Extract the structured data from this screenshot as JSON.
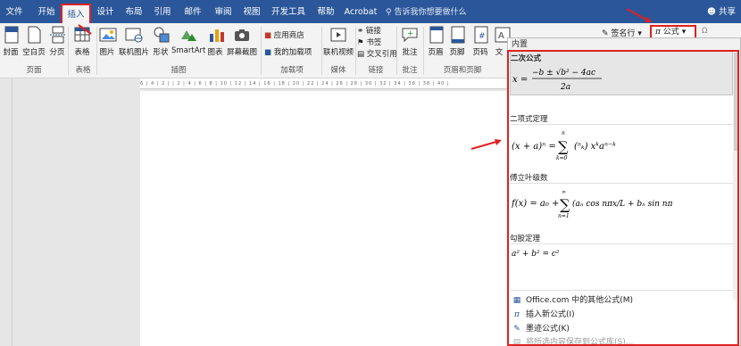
{
  "tabs": [
    {
      "label": "文件",
      "active": false
    },
    {
      "label": "开始",
      "active": false
    },
    {
      "label": "插入",
      "active": true
    },
    {
      "label": "设计",
      "active": false
    },
    {
      "label": "布局",
      "active": false
    },
    {
      "label": "引用",
      "active": false
    },
    {
      "label": "邮件",
      "active": false
    },
    {
      "label": "审阅",
      "active": false
    },
    {
      "label": "视图",
      "active": false
    },
    {
      "label": "开发工具",
      "active": false
    },
    {
      "label": "帮助",
      "active": false
    },
    {
      "label": "Acrobat",
      "active": false
    }
  ],
  "tell_me": "告诉我你想要做什么",
  "share": "共享",
  "ribbon": {
    "cover": "封面",
    "blank_page": "空白页",
    "page_break": "分页",
    "table": "表格",
    "picture": "图片",
    "online_picture": "联机图片",
    "shapes": "形状",
    "smartart": "SmartArt",
    "chart": "图表",
    "screenshot": "屏幕截图",
    "store": "应用商店",
    "my_addins": "我的加载项",
    "online_video": "联机视频",
    "link": "链接",
    "bookmark": "书签",
    "cross_ref": "交叉引用",
    "comment": "批注",
    "header": "页眉",
    "footer": "页脚",
    "page_number": "页码",
    "textbox": "文",
    "signature_line": "签名行",
    "equation": "公式"
  },
  "groups": {
    "pages": "页面",
    "tables": "表格",
    "illustrations": "插图",
    "addins": "加载项",
    "media": "媒体",
    "links": "链接",
    "comments": "批注",
    "header_footer": "页眉和页脚"
  },
  "panel": {
    "title": "内置",
    "sections": [
      {
        "title": "二次公式"
      },
      {
        "title": "二项式定理"
      },
      {
        "title": "傅立叶级数"
      },
      {
        "title": "勾股定理"
      }
    ],
    "menu": [
      {
        "label": "Office.com 中的其他公式(M)",
        "icon": "office-icon",
        "disabled": false
      },
      {
        "label": "插入新公式(I)",
        "icon": "pi-icon",
        "disabled": false
      },
      {
        "label": "墨迹公式(K)",
        "icon": "ink-icon",
        "disabled": false
      },
      {
        "label": "将所选内容保存到公式库(S)...",
        "icon": "save-icon",
        "disabled": true
      }
    ]
  },
  "ruler_marks": "6 | 4 | 2 |  | 2 | 4 | 6 | 8 | 10 | 12 | 14 | 16 | 18 | 20 | 22 | 24 | 26 | 28 | 30 | 32 | 34 | 36 | 38 | 40 |",
  "colors": {
    "accent": "#2b579a",
    "highlight": "#e02020"
  }
}
